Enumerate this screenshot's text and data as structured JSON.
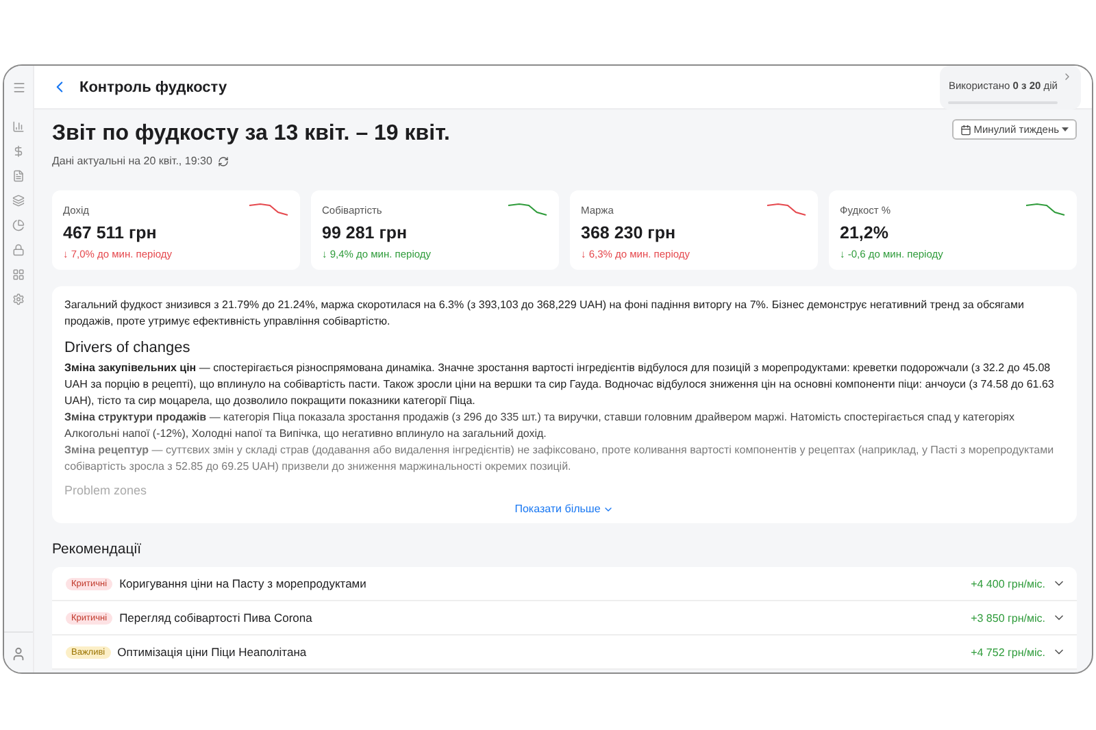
{
  "header": {
    "title": "Контроль фудкосту",
    "usage": {
      "text": "Використано **0 з 20** дій",
      "level": 0
    }
  },
  "report": {
    "title": "Звіт по фудкосту за 13 квіт. – 19 квіт.",
    "updated": "Дані актуальні на 20 квіт., 19:30",
    "period": "Минулий тиждень"
  },
  "metrics": [
    {
      "label": "Дохід",
      "value": "467 511 грн",
      "change": "↓ 7,0% до мин. періоду",
      "color": "#e5484d"
    },
    {
      "label": "Собівартість",
      "value": "99 281 грн",
      "change": "↓ 9,4% до мин. періоду",
      "color": "#2e9b3a"
    },
    {
      "label": "Маржа",
      "value": "368 230 грн",
      "change": "↓ 6,3% до мин. періоду",
      "color": "#e5484d"
    },
    {
      "label": "Фудкост %",
      "value": "21,2%",
      "change": "↓ -0,6 до мин. періоду",
      "color": "#2e9b3a"
    }
  ],
  "summary": {
    "intro": "Загальний фудкост знизився з 21.79% до 21.24%, маржа скоротилася на 6.3% (з 393,103 до 368,229 UAH) на фоні падіння виторгу на 7%. Бізнес демонструє негативний тренд за обсягами продажів, проте утримує ефективність управління собівартістю.",
    "drivers_title": "Drivers of changes",
    "drivers": [
      "**Зміна закупівельних цін** — спостерігається різноспрямована динаміка. Значне зростання вартості інгредієнтів відбулося для позицій з морепродуктами: креветки подорожчали (з 32.2 до 45.08 UAH за порцію в рецепті), що вплинуло на собівартість пасти. Також зросли ціни на вершки та сир Гауда. Водночас відбулося зниження цін на основні компоненти піци: анчоуси (з 74.58 до 61.63 UAH), тісто та сир моцарела, що дозволило покращити показники категорії Піца.",
      "**Зміна структури продажів** — категорія Піца показала зростання продажів (з 296 до 335 шт.) та виручки, ставши головним драйвером маржі. Натомість спостерігається спад у категоріях Алкогольні напої (-12%), Холодні напої та Випічка, що негативно вплинуло на загальний дохід.",
      "**Зміна рецептур** — суттєвих змін у складі страв (додавання або видалення інгредієнтів) не зафіксовано, проте коливання вартості компонентів у рецептах (наприклад, у Пасті з морепродуктами собівартість зросла з 52.85 до 69.25 UAH) призвели до зниження маржинальності окремих позицій."
    ],
    "next_title": "Problem zones",
    "more": "Показати більше"
  },
  "recommendations": {
    "title": "Рекомендації",
    "items": [
      {
        "kind": "critical",
        "badge": "Критичні",
        "title": "Коригування ціни на Пасту з морепродуктами",
        "effect": "+4 400 грн/міс.",
        "expanded": false
      },
      {
        "kind": "critical",
        "badge": "Критичні",
        "title": "Перегляд собівартості Пива Corona",
        "effect": "+3 850 грн/міс.",
        "expanded": false
      },
      {
        "kind": "important",
        "badge": "Важливі",
        "title": "Оптимізація ціни Піци Неаполітана",
        "effect": "+4 752 грн/міс.",
        "expanded": false
      }
    ]
  }
}
